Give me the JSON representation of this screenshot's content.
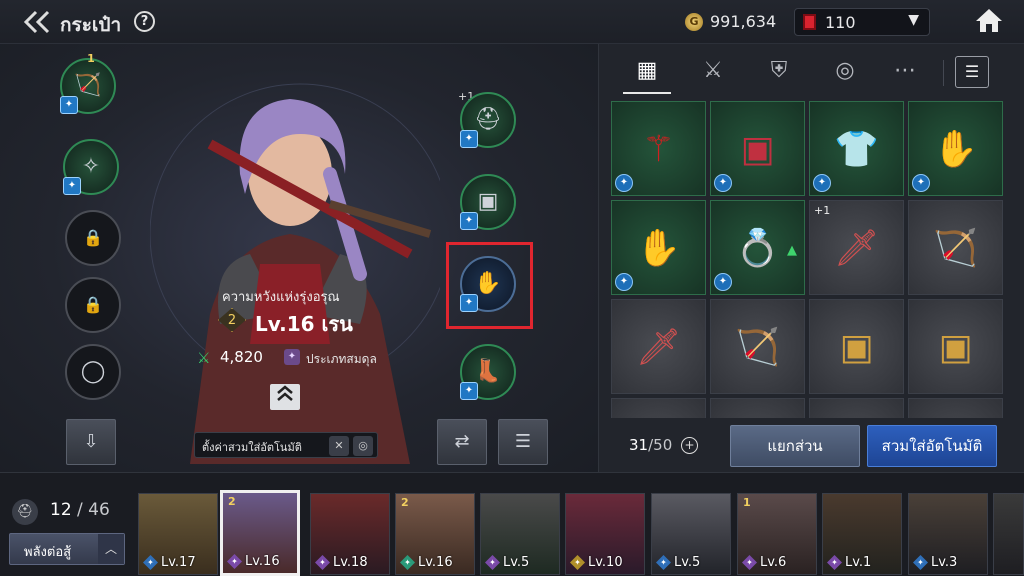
{
  "header": {
    "back_icon": "double-chevron-left-icon",
    "title": "กระเป๋า",
    "help": "?",
    "gold_icon_letter": "G",
    "gold": "991,634",
    "gems": "110",
    "home_icon": "home-icon"
  },
  "character": {
    "title": "ความหวังแห่งรุ่งอรุณ",
    "tier": "2",
    "level_name": "Lv.16 เรน",
    "power": "4,820",
    "type": "ประเภทสมดุล",
    "left_slots": [
      {
        "tier": "1"
      }
    ],
    "right_slots": [
      {
        "plus": "+1"
      }
    ],
    "auto_setting_label": "ตั้งค่าสวมใส่อัตโนมัติ"
  },
  "inventory": {
    "tabs": [
      "all",
      "weapon",
      "armor",
      "accessory",
      "etc"
    ],
    "items": [
      {
        "plus": ""
      },
      {
        "plus": ""
      },
      {
        "plus": ""
      },
      {
        "plus": ""
      },
      {
        "plus": ""
      },
      {
        "plus": ""
      },
      {
        "plus": "+1"
      },
      {
        "plus": ""
      },
      {
        "plus": ""
      },
      {
        "plus": ""
      },
      {
        "plus": ""
      },
      {
        "plus": ""
      }
    ],
    "count": "31",
    "count_total": "/50",
    "dismantle_label": "แยกส่วน",
    "auto_equip_label": "สวมใส่อัตโนมัติ"
  },
  "roster": {
    "count": "12",
    "total": "/ 46",
    "power_button": "พลังต่อสู้",
    "heroes": [
      {
        "lv": "Lv.17",
        "tier": "",
        "cls_color": "#2f6fb8"
      },
      {
        "lv": "Lv.16",
        "tier": "2",
        "cls_color": "#7a4aa8"
      },
      {
        "lv": "Lv.18",
        "tier": "",
        "cls_color": "#7a4aa8"
      },
      {
        "lv": "Lv.16",
        "tier": "2",
        "cls_color": "#2a9a7a"
      },
      {
        "lv": "Lv.5",
        "tier": "",
        "cls_color": "#7a4aa8"
      },
      {
        "lv": "Lv.10",
        "tier": "",
        "cls_color": "#b0902a"
      },
      {
        "lv": "Lv.5",
        "tier": "",
        "cls_color": "#2f6fb8"
      },
      {
        "lv": "Lv.6",
        "tier": "1",
        "cls_color": "#7a4aa8"
      },
      {
        "lv": "Lv.1",
        "tier": "",
        "cls_color": "#7a4aa8"
      },
      {
        "lv": "Lv.3",
        "tier": "",
        "cls_color": "#2f6fb8"
      }
    ]
  },
  "colors": {
    "selection_red": "#e0262f",
    "primary_blue": "#2d5fbd",
    "gold": "#f2d060"
  }
}
